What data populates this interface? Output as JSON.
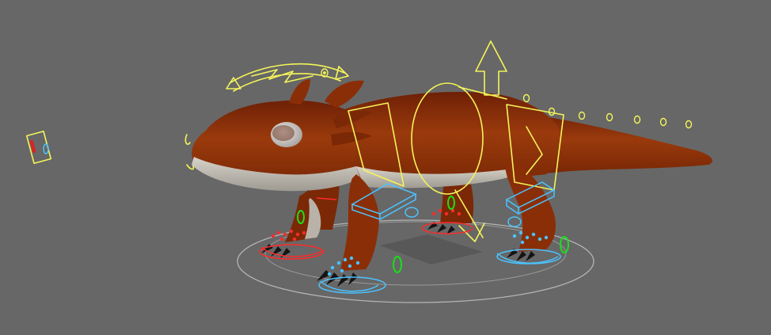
{
  "viewport": {
    "background": "#676767",
    "grid": false
  },
  "scene": {
    "model": "lizard-creature",
    "body_color": "#8a2e08",
    "belly_color": "#c9c4b8",
    "claw_color": "#141414"
  },
  "rig": {
    "spine_control_color": "#f4f45a",
    "left_limb_color": "#4cc3ff",
    "right_limb_color": "#ff2a2a",
    "pole_vector_color": "#19e019",
    "root_ring_color": "#b4b4b4",
    "tail_control_count": 7
  }
}
